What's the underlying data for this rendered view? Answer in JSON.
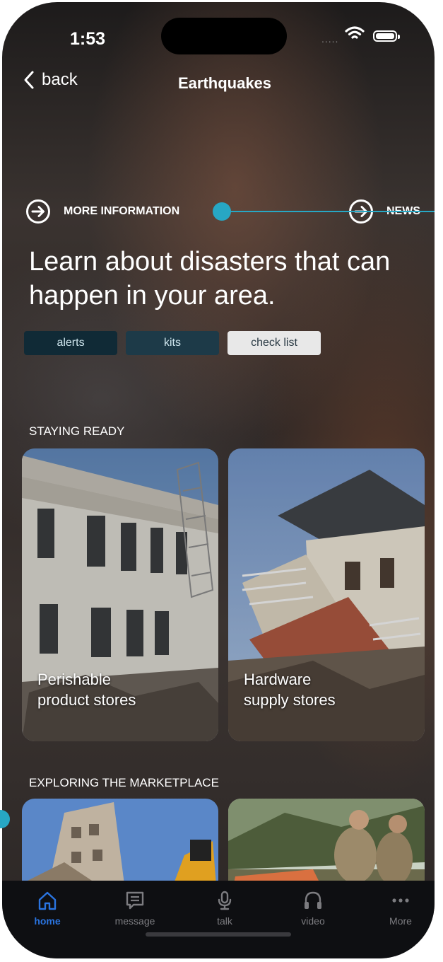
{
  "status_bar": {
    "time": "1:53",
    "signal": "....."
  },
  "nav": {
    "back_label": "back",
    "title": "Earthquakes"
  },
  "links": {
    "more_info": "MORE INFORMATION",
    "news": "NEWS"
  },
  "headline": "Learn about disasters that can happen in your area.",
  "chips": [
    "alerts",
    "kits",
    "check list"
  ],
  "sections": {
    "staying_ready": {
      "label": "STAYING READY",
      "cards": [
        {
          "line1": "Perishable",
          "line2": "product stores"
        },
        {
          "line1": "Hardware",
          "line2": "supply stores"
        }
      ]
    },
    "marketplace": {
      "label": "EXPLORING THE MARKETPLACE"
    }
  },
  "tabbar": {
    "tabs": [
      {
        "label": "home",
        "icon": "home-icon",
        "active": true
      },
      {
        "label": "message",
        "icon": "message-icon",
        "active": false
      },
      {
        "label": "talk",
        "icon": "microphone-icon",
        "active": false
      },
      {
        "label": "video",
        "icon": "headphones-icon",
        "active": false
      },
      {
        "label": "More",
        "icon": "more-dots-icon",
        "active": false
      }
    ]
  },
  "colors": {
    "accent": "#27a7c4",
    "active_tab": "#2a74e0",
    "chip_selected": "#e8e8e8"
  }
}
